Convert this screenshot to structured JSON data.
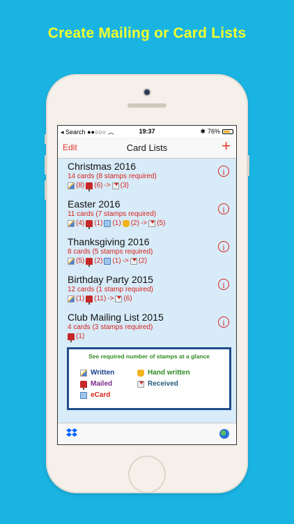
{
  "headline": "Create Mailing or Card Lists",
  "status_bar": {
    "back_label": "Search",
    "time": "19:37",
    "battery": "76%",
    "battery_fraction": 0.76
  },
  "navbar": {
    "edit_label": "Edit",
    "title": "Card Lists",
    "add_label": "+"
  },
  "lists": [
    {
      "title": "Christmas 2016",
      "summary": "14 cards (8 stamps required)",
      "written": "(8)",
      "mailed": "(6)",
      "arrow": "->",
      "received": "(3)"
    },
    {
      "title": "Easter 2016",
      "summary": "11 cards (7 stamps required)",
      "written": "(4)",
      "mailed": "(1)",
      "ecard": "(1)",
      "hand": "(2)",
      "arrow": "->",
      "received": "(5)"
    },
    {
      "title": "Thanksgiving 2016",
      "summary": "8 cards (5 stamps required)",
      "written": "(5)",
      "mailed": "(2)",
      "ecard": "(1)",
      "arrow": "->",
      "received": "(2)"
    },
    {
      "title": "Birthday Party 2015",
      "summary": "12 cards (1 stamp required)",
      "written": "(1)",
      "mailed": "(11)",
      "arrow": "->",
      "received": "(6)"
    },
    {
      "title": "Club Mailing List 2015",
      "summary": "4 cards (3 stamps required)",
      "mailed": "(1)"
    }
  ],
  "legend": {
    "heading": "See required number of stamps at a glance",
    "written": "Written",
    "mailed": "Mailed",
    "ecard": "eCard",
    "hand_written": "Hand written",
    "received": "Received",
    "colors": {
      "written": "#1a3e8c",
      "mailed": "#7b2a8c",
      "ecard": "#d6231b",
      "hand_written": "#2e8b20",
      "received": "#1f5a7a"
    }
  },
  "colors": {
    "background": "#1ab4e3",
    "headline": "#f2ff2d",
    "accent": "#e0352b",
    "list_background": "#d8ebf8"
  }
}
